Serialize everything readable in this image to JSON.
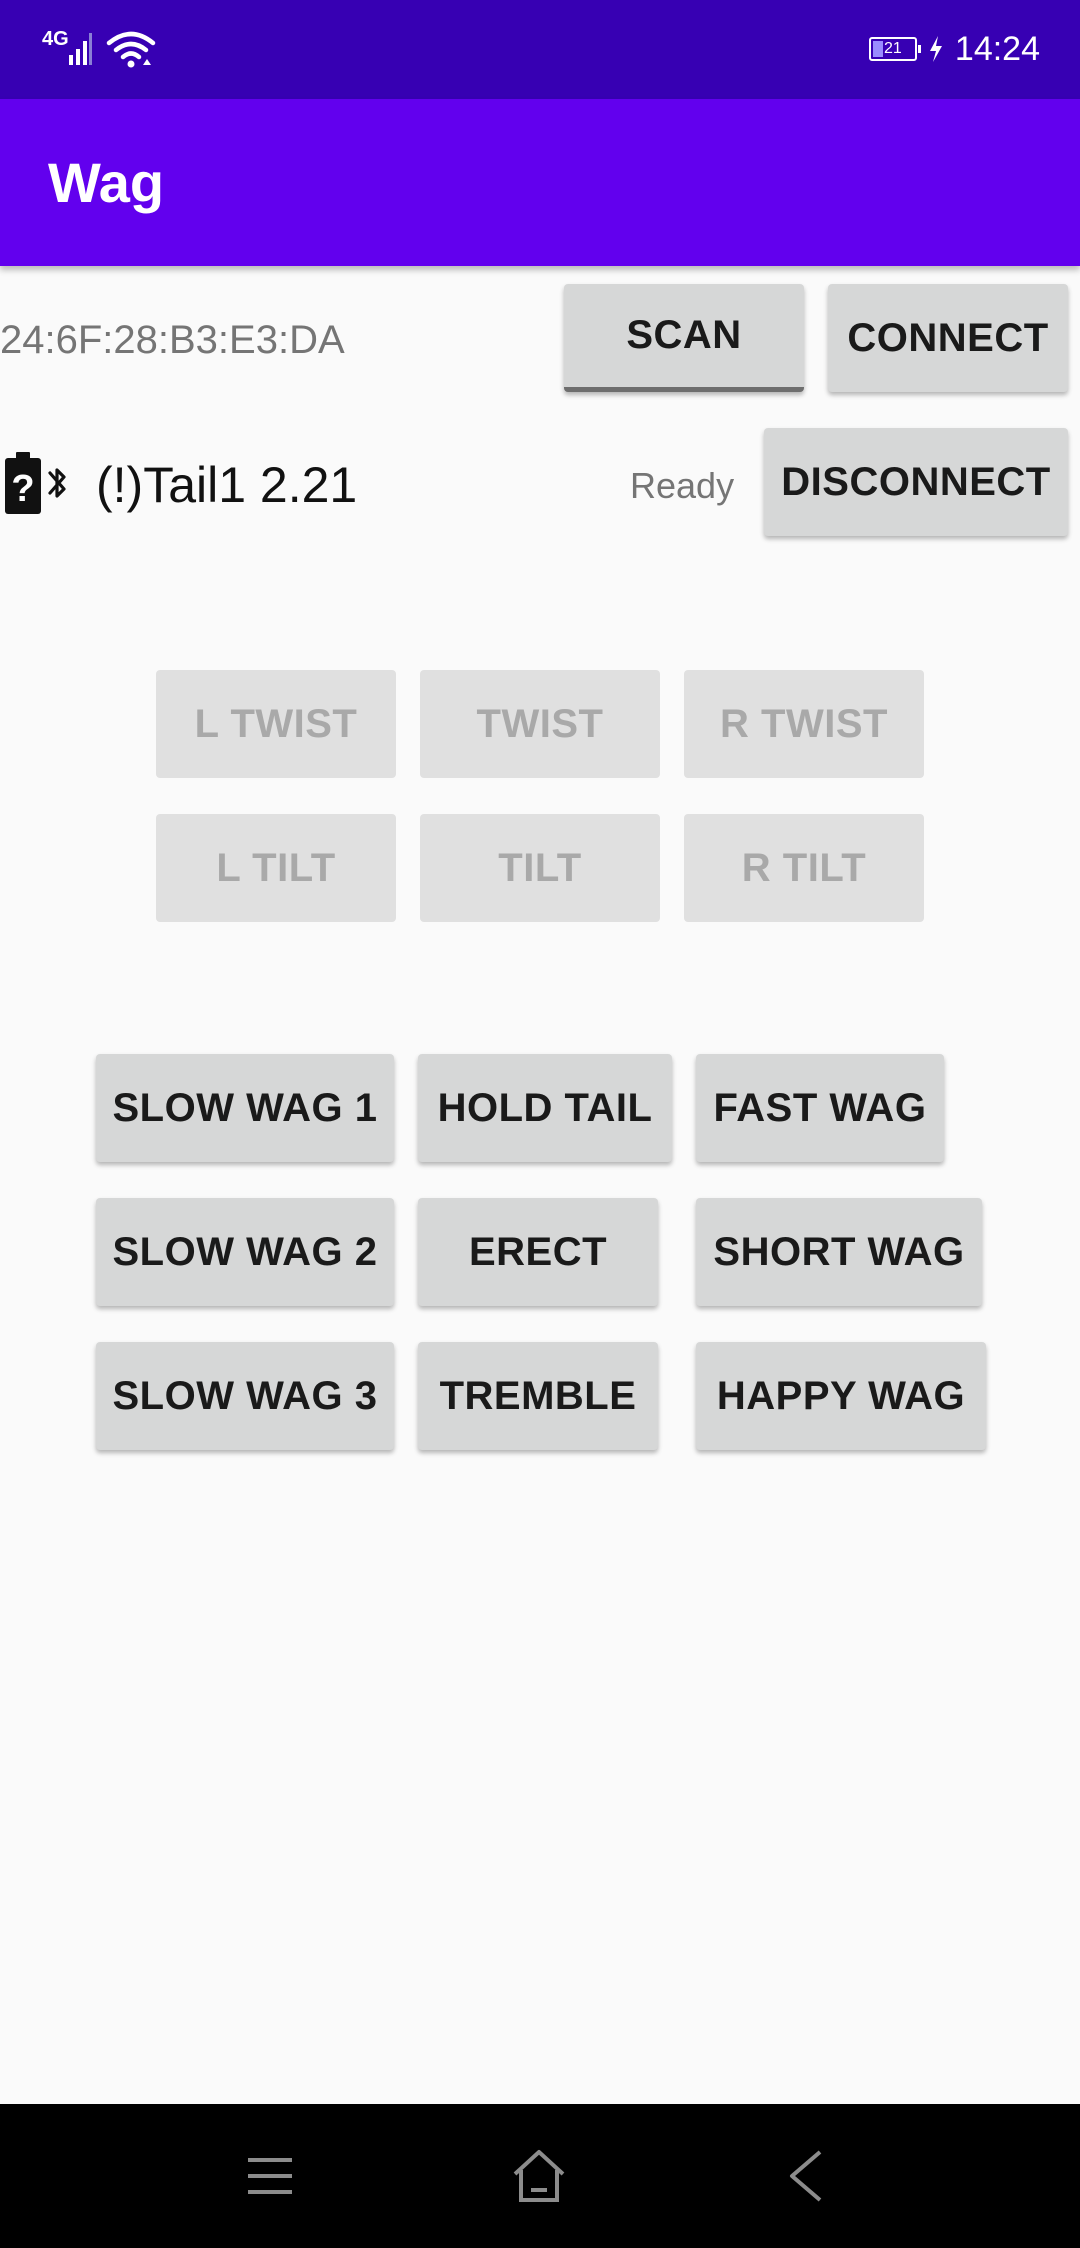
{
  "status_bar": {
    "network": "4G",
    "battery_level": "21",
    "time": "14:24",
    "icons": [
      "signal-icon",
      "wifi-icon",
      "battery-icon",
      "charging-icon"
    ]
  },
  "app_bar": {
    "title": "Wag"
  },
  "connection": {
    "mac_address": "24:6F:28:B3:E3:DA",
    "scan_label": "SCAN",
    "connect_label": "CONNECT"
  },
  "device": {
    "icons": [
      "battery-unknown-icon",
      "bluetooth-icon"
    ],
    "name": "(!)Tail1 2.21",
    "status": "Ready",
    "disconnect_label": "DISCONNECT"
  },
  "movement_buttons": {
    "l_twist": "L TWIST",
    "twist": "TWIST",
    "r_twist": "R TWIST",
    "l_tilt": "L TILT",
    "tilt": "TILT",
    "r_tilt": "R TILT"
  },
  "wag_buttons": {
    "slow_wag_1": "SLOW WAG 1",
    "hold_tail": "HOLD TAIL",
    "fast_wag": "FAST WAG",
    "slow_wag_2": "SLOW WAG 2",
    "erect": "ERECT",
    "short_wag": "SHORT WAG",
    "slow_wag_3": "SLOW WAG 3",
    "tremble": "TREMBLE",
    "happy_wag": "HAPPY WAG"
  },
  "nav_bar": {
    "icons": [
      "menu-icon",
      "home-icon",
      "back-icon"
    ]
  },
  "colors": {
    "status_bar": "#3700b3",
    "app_bar": "#6200ee",
    "background": "#fafafa",
    "button": "#d6d7d7",
    "button_disabled": "#e0e0e0"
  }
}
